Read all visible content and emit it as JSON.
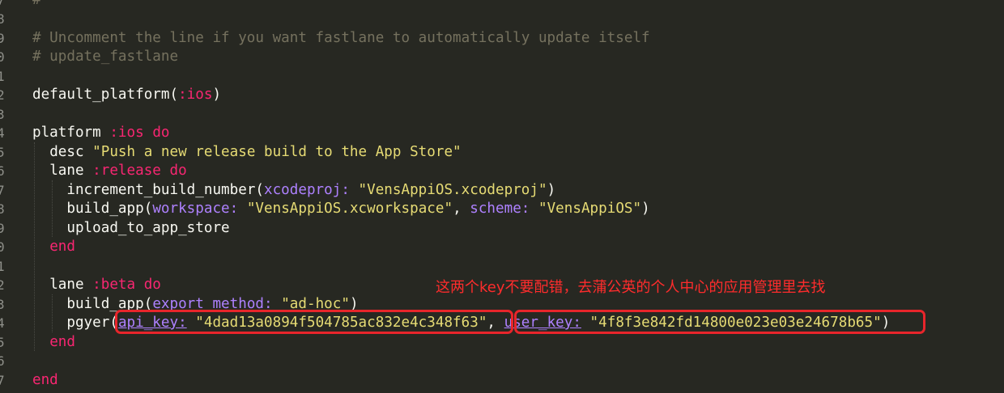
{
  "line_numbers": [
    "7",
    "8",
    "9",
    "0",
    "1",
    "2",
    "3",
    "4",
    "5",
    "6",
    "7",
    "8",
    "9",
    "0",
    "1",
    "2",
    "3",
    "4",
    "5",
    "6",
    "7"
  ],
  "code": {
    "l7_comment": "#",
    "l9_comment": "# Uncomment the line if you want fastlane to automatically update itself",
    "l10_comment": "# update_fastlane",
    "l12_fn": "default_platform(",
    "l12_sym": ":ios",
    "l12_close": ")",
    "l14_kw1": "platform",
    "l14_sym": ":ios",
    "l14_do": "do",
    "l15_fn": "desc",
    "l15_str": "\"Push a new release build to the App Store\"",
    "l16_fn": "lane",
    "l16_sym": ":release",
    "l16_do": "do",
    "l17_fn": "increment_build_number(",
    "l17_arg": "xcodeproj:",
    "l17_str": "\"VensAppiOS.xcodeproj\"",
    "l17_close": ")",
    "l18_fn": "build_app(",
    "l18_arg1": "workspace:",
    "l18_str1": "\"VensAppiOS.xcworkspace\"",
    "l18_comma": ",",
    "l18_arg2": "scheme:",
    "l18_str2": "\"VensAppiOS\"",
    "l18_close": ")",
    "l19_fn": "upload_to_app_store",
    "l20_end": "end",
    "l22_fn": "lane",
    "l22_sym": ":beta",
    "l22_do": "do",
    "l23_fn": "build_app(",
    "l23_arg": "export_method:",
    "l23_str": "\"ad-hoc\"",
    "l23_close": ")",
    "l24_fn": "pgyer(",
    "l24_arg1": "api_key:",
    "l24_str1": "\"4dad13a0894f504785ac832e4c348f63\"",
    "l24_comma": ",",
    "l24_arg2": "user_key:",
    "l24_str2": "\"4f8f3e842fd14800e023e03e24678b65\"",
    "l24_close": ")",
    "l25_end": "end",
    "l27_end": "end"
  },
  "annotation": {
    "note": "这两个key不要配错，去蒲公英的个人中心的应用管理里去找",
    "color": "#e8252b"
  },
  "theme": {
    "background": "#272822",
    "comment": "#75715e",
    "string": "#e6db74",
    "keyword": "#f92672",
    "symbol": "#ae81ff",
    "text": "#f8f8f2"
  }
}
